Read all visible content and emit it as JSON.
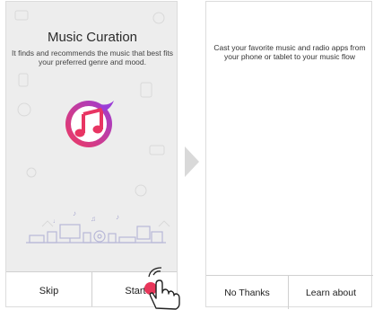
{
  "left_screen": {
    "title": "Music Curation",
    "subtitle": "It finds and recommends the music that best fits your preferred genre and mood.",
    "skip_label": "Skip",
    "start_label": "Start"
  },
  "right_screen": {
    "message": "Cast your favorite music and radio apps from your phone or tablet to your music flow",
    "no_thanks_label": "No Thanks",
    "learn_about_label": "Learn about"
  },
  "icons": {
    "logo": "music-note-icon",
    "devices": "devices-illustration",
    "pointer": "hand-pointer-icon",
    "arrow": "chevron-right-icon"
  },
  "colors": {
    "logo_gradient_start": "#f03a5f",
    "logo_gradient_end": "#9b3dd6",
    "tap_indicator": "#e8365a",
    "screen_bg": "#ededed"
  }
}
